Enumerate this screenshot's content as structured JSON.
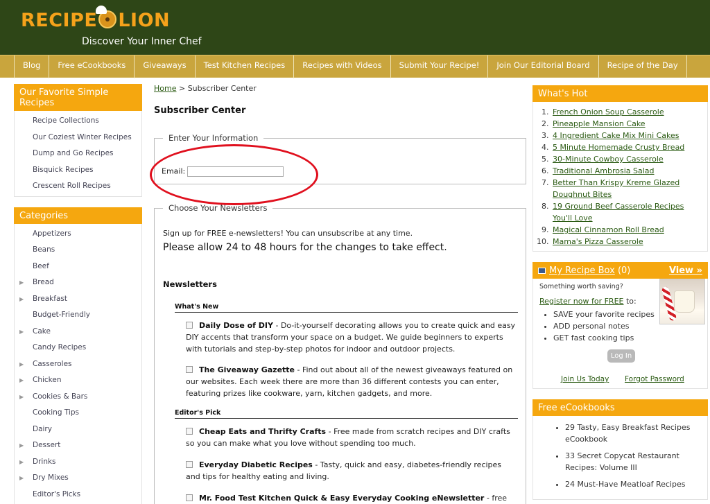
{
  "header": {
    "logo_text_left": "RECIPE",
    "logo_text_right": "LION",
    "tagline": "Discover Your Inner Chef"
  },
  "nav": {
    "items": [
      "Blog",
      "Free eCookbooks",
      "Giveaways",
      "Test Kitchen Recipes",
      "Recipes with Videos",
      "Submit Your Recipe!",
      "Join Our Editorial Board",
      "Recipe of the Day"
    ]
  },
  "sidebar": {
    "favorites_title": "Our Favorite Simple Recipes",
    "favorites": [
      "Recipe Collections",
      "Our Coziest Winter Recipes",
      "Dump and Go Recipes",
      "Bisquick Recipes",
      "Crescent Roll Recipes"
    ],
    "categories_title": "Categories",
    "categories": [
      {
        "label": "Appetizers",
        "arrow": false
      },
      {
        "label": "Beans",
        "arrow": false
      },
      {
        "label": "Beef",
        "arrow": false
      },
      {
        "label": "Bread",
        "arrow": true
      },
      {
        "label": "Breakfast",
        "arrow": true
      },
      {
        "label": "Budget-Friendly",
        "arrow": false
      },
      {
        "label": "Cake",
        "arrow": true
      },
      {
        "label": "Candy Recipes",
        "arrow": false
      },
      {
        "label": "Casseroles",
        "arrow": true
      },
      {
        "label": "Chicken",
        "arrow": true
      },
      {
        "label": "Cookies & Bars",
        "arrow": true
      },
      {
        "label": "Cooking Tips",
        "arrow": false
      },
      {
        "label": "Dairy",
        "arrow": false
      },
      {
        "label": "Dessert",
        "arrow": true
      },
      {
        "label": "Drinks",
        "arrow": true
      },
      {
        "label": "Dry Mixes",
        "arrow": true
      },
      {
        "label": "Editor's Picks",
        "arrow": false
      }
    ],
    "arrow_glyph": "▶"
  },
  "main": {
    "breadcrumb_home": "Home",
    "breadcrumb_sep": " > ",
    "breadcrumb_current": "Subscriber Center",
    "title": "Subscriber Center",
    "info_legend": "Enter Your Information",
    "email_label": "Email:",
    "email_value": "",
    "newsletters_legend": "Choose Your Newsletters",
    "intro": "Sign up for FREE e-newsletters! You can unsubscribe at any time.",
    "note": "Please allow 24 to 48 hours for the changes to take effect.",
    "newsletters_heading": "Newsletters",
    "whats_new": "What's New",
    "editors_pick": "Editor's Pick",
    "items": [
      {
        "title": "Daily Dose of DIY",
        "desc": " - Do-it-yourself decorating allows you to create quick and easy DIY accents that transform your space on a budget. We guide beginners to experts with tutorials and step-by-step photos for indoor and outdoor projects."
      },
      {
        "title": "The Giveaway Gazette",
        "desc": " - Find out about all of the newest giveaways featured on our websites. Each week there are more than 36 different contests you can enter, featuring prizes like cookware, yarn, kitchen gadgets, and more."
      },
      {
        "title": "Cheap Eats and Thrifty Crafts",
        "desc": " - Free made from scratch recipes and DIY crafts so you can make what you love without spending too much."
      },
      {
        "title": "Everyday Diabetic Recipes",
        "desc": " - Tasty, quick and easy, diabetes-friendly recipes and tips for healthy eating and living."
      },
      {
        "title": "Mr. Food Test Kitchen Quick & Easy Everyday Cooking eNewsletter",
        "desc": " - free recipes,"
      }
    ]
  },
  "right": {
    "hot_title": "What's Hot",
    "hot": [
      "French Onion Soup Casserole",
      "Pineapple Mansion Cake",
      "4 Ingredient Cake Mix Mini Cakes",
      "5 Minute Homemade Crusty Bread",
      "30-Minute Cowboy Casserole",
      "Traditional Ambrosia Salad",
      "Better Than Krispy Kreme Glazed Doughnut Bites",
      "19 Ground Beef Casserole Recipes You'll Love",
      "Magical Cinnamon Roll Bread",
      "Mama's Pizza Casserole"
    ],
    "recipe_box_title": "My Recipe Box",
    "recipe_box_count": "(0)",
    "view_link": "View »",
    "worth_saving": "Something worth saving?",
    "register_link": "Register now for FREE",
    "register_suffix": " to:",
    "perks": [
      "SAVE your favorite recipes",
      "ADD personal notes",
      "GET fast cooking tips"
    ],
    "login_label": "Log In",
    "join_label": "Join Us Today",
    "forgot_label": "Forgot Password",
    "ecookbooks_title": "Free eCookbooks",
    "ecookbooks": [
      "29 Tasty, Easy Breakfast Recipes eCookbook",
      "33 Secret Copycat Restaurant Recipes: Volume III",
      "24 Must-Have Meatloaf Recipes"
    ]
  },
  "colors": {
    "header_bg": "#2e4617",
    "nav_bg": "#c9a53d",
    "accent_orange": "#f5a70f",
    "link_green": "#2a5a12",
    "highlight_red": "#e0101e"
  }
}
